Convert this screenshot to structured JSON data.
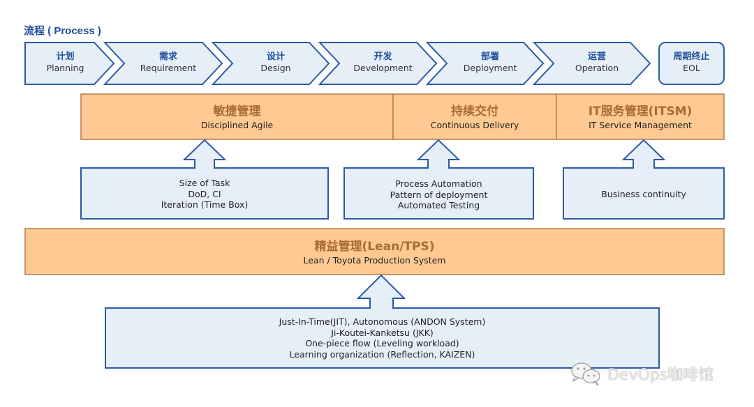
{
  "title": "流程 ( Process )",
  "process_stages": [
    {
      "cn": "计划",
      "en": "Planning"
    },
    {
      "cn": "需求",
      "en": "Requirement"
    },
    {
      "cn": "设计",
      "en": "Design"
    },
    {
      "cn": "开发",
      "en": "Development"
    },
    {
      "cn": "部署",
      "en": "Deployment"
    },
    {
      "cn": "运营",
      "en": "Operation"
    }
  ],
  "end_stage": {
    "cn": "周期终止",
    "en": "EOL"
  },
  "management_bands": [
    {
      "cn": "敏捷管理",
      "en": "Disciplined Agile"
    },
    {
      "cn": "持续交付",
      "en": "Continuous Delivery"
    },
    {
      "cn": "IT服务管理(ITSM)",
      "en": "IT Service Management"
    }
  ],
  "practice_boxes": [
    {
      "lines": [
        "Size of Task",
        "DoD, CI",
        "Iteration (Time Box)"
      ]
    },
    {
      "lines": [
        "Process Automation",
        "Pattern of deployment",
        "Automated Testing"
      ]
    },
    {
      "lines": [
        "Business continuity"
      ]
    }
  ],
  "lean_band": {
    "cn": "精益管理(Lean/TPS)",
    "en": "Lean / Toyota Production System"
  },
  "lean_practices": {
    "lines": [
      "Just-In-Time(JIT), Autonomous (ANDON System)",
      "Ji-Koutei-Kanketsu (JKK)",
      "One-piece flow (Leveling workload)",
      "Learning organization (Reflection, KAIZEN)"
    ]
  },
  "watermark": "DevOps咖啡馆",
  "colors": {
    "blue_fill": "#e6eef8",
    "blue_stroke": "#2a5aa8",
    "orange_fill": "#ffc993",
    "orange_stroke": "#b07a4a",
    "title_blue": "#1f4e9a"
  }
}
